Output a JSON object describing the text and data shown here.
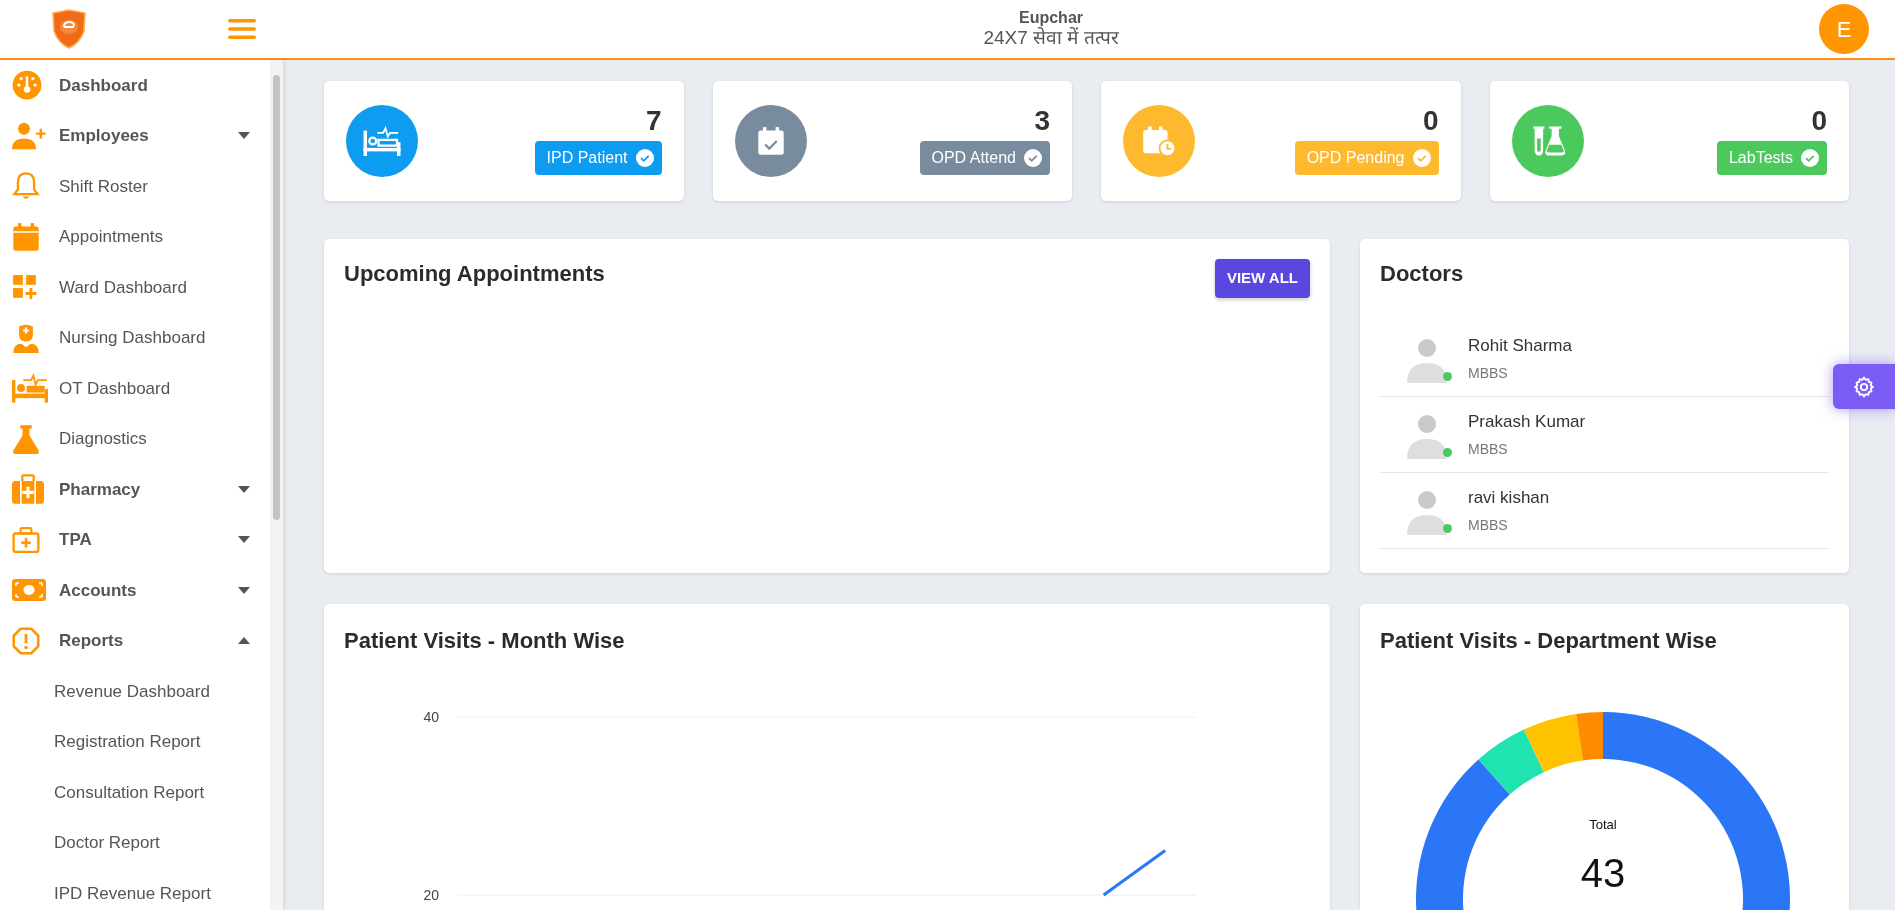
{
  "header": {
    "title": "Eupchar",
    "tagline": "24X7 सेवा में तत्पर",
    "avatar_initial": "E"
  },
  "sidebar": {
    "items": [
      {
        "label": "Dashboard",
        "kind": "header"
      },
      {
        "label": "Employees",
        "kind": "header",
        "expanded": false
      },
      {
        "label": "Shift Roster",
        "kind": "link"
      },
      {
        "label": "Appointments",
        "kind": "link"
      },
      {
        "label": "Ward Dashboard",
        "kind": "link"
      },
      {
        "label": "Nursing Dashboard",
        "kind": "link"
      },
      {
        "label": "OT Dashboard",
        "kind": "link"
      },
      {
        "label": "Diagnostics",
        "kind": "link"
      },
      {
        "label": "Pharmacy",
        "kind": "header",
        "expanded": false
      },
      {
        "label": "TPA",
        "kind": "header",
        "expanded": false
      },
      {
        "label": "Accounts",
        "kind": "header",
        "expanded": false
      },
      {
        "label": "Reports",
        "kind": "header",
        "expanded": true,
        "children": [
          {
            "label": "Revenue Dashboard"
          },
          {
            "label": "Registration Report"
          },
          {
            "label": "Consultation Report"
          },
          {
            "label": "Doctor Report"
          },
          {
            "label": "IPD Revenue Report"
          }
        ]
      }
    ]
  },
  "stats": [
    {
      "value": "7",
      "label": "IPD Patient",
      "color": "#0d9cf0"
    },
    {
      "value": "3",
      "label": "OPD Attend",
      "color": "#798c9e"
    },
    {
      "value": "0",
      "label": "OPD Pending",
      "color": "#ffb92e"
    },
    {
      "value": "0",
      "label": "LabTests",
      "color": "#4cc95d"
    }
  ],
  "appointments": {
    "title": "Upcoming Appointments",
    "button": "VIEW ALL"
  },
  "doctors": {
    "title": "Doctors",
    "items": [
      {
        "name": "Rohit Sharma",
        "degree": "MBBS",
        "online": true
      },
      {
        "name": "Prakash Kumar",
        "degree": "MBBS",
        "online": true
      },
      {
        "name": "ravi kishan",
        "degree": "MBBS",
        "online": true
      }
    ]
  },
  "month_chart": {
    "title": "Patient Visits - Month Wise",
    "chart_data": {
      "type": "line",
      "categories": [
        null,
        null,
        null,
        null,
        null,
        null,
        null,
        null,
        null,
        null,
        null,
        null
      ],
      "ylim": [
        20,
        40
      ],
      "yticks": [
        20,
        40
      ],
      "series": [
        {
          "color": "#2b76f6",
          "values": [
            null,
            null,
            null,
            null,
            null,
            null,
            null,
            null,
            null,
            null,
            20,
            25
          ]
        }
      ]
    }
  },
  "department_chart": {
    "title": "Patient Visits - Department Wise",
    "center_label": "Total",
    "center_value": "43",
    "chart_data": {
      "type": "donut",
      "values": [
        88.4,
        4.65,
        4.65,
        2.3
      ],
      "colors": [
        "#2b76f6",
        "#20e3b2",
        "#ffc300",
        "#ff8c00"
      ]
    }
  }
}
